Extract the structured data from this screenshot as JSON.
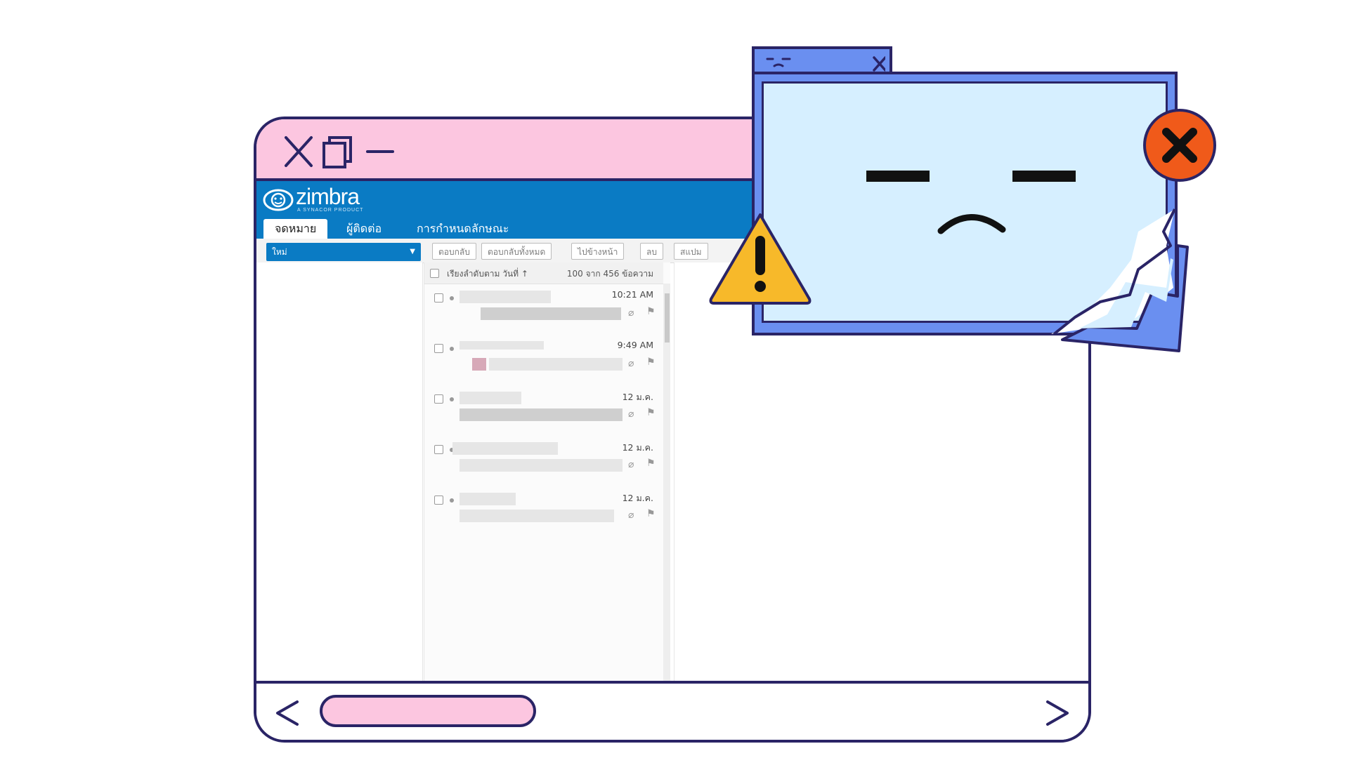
{
  "colors": {
    "outline": "#2a2466",
    "pink": "#fcc6e0",
    "zimbra_blue": "#0a7bc4",
    "error_window": "#6a8ff0",
    "error_screen": "#d6efff",
    "warning": "#f7b92a",
    "error_badge": "#f05a1a"
  },
  "zimbra": {
    "logo_text": "zimbra",
    "logo_sub": "A SYNACOR PRODUCT",
    "tabs": [
      "จดหมาย",
      "ผู้ติดต่อ",
      "การกำหนดลักษณะ"
    ],
    "new_button": "ใหม่",
    "toolbar": [
      "ตอบกลับ",
      "ตอบกลับทั้งหมด",
      "ไปข้างหน้า",
      "ลบ",
      "สแปม"
    ],
    "list_header": {
      "sort": "เรียงลำดับตาม วันที่",
      "count": "100 จาก 456 ข้อความ"
    },
    "messages": [
      {
        "time": "10:21 AM"
      },
      {
        "time": "9:49 AM"
      },
      {
        "time": "12 ม.ค."
      },
      {
        "time": "12 ม.ค."
      },
      {
        "time": "12 ม.ค."
      }
    ]
  },
  "icons": {
    "window_controls": [
      "close-icon",
      "restore-icon",
      "minimize-icon"
    ],
    "scroll": [
      "chevron-left-icon",
      "chevron-right-icon"
    ],
    "error": [
      "sad-face-icon",
      "warning-icon",
      "error-x-icon"
    ]
  }
}
